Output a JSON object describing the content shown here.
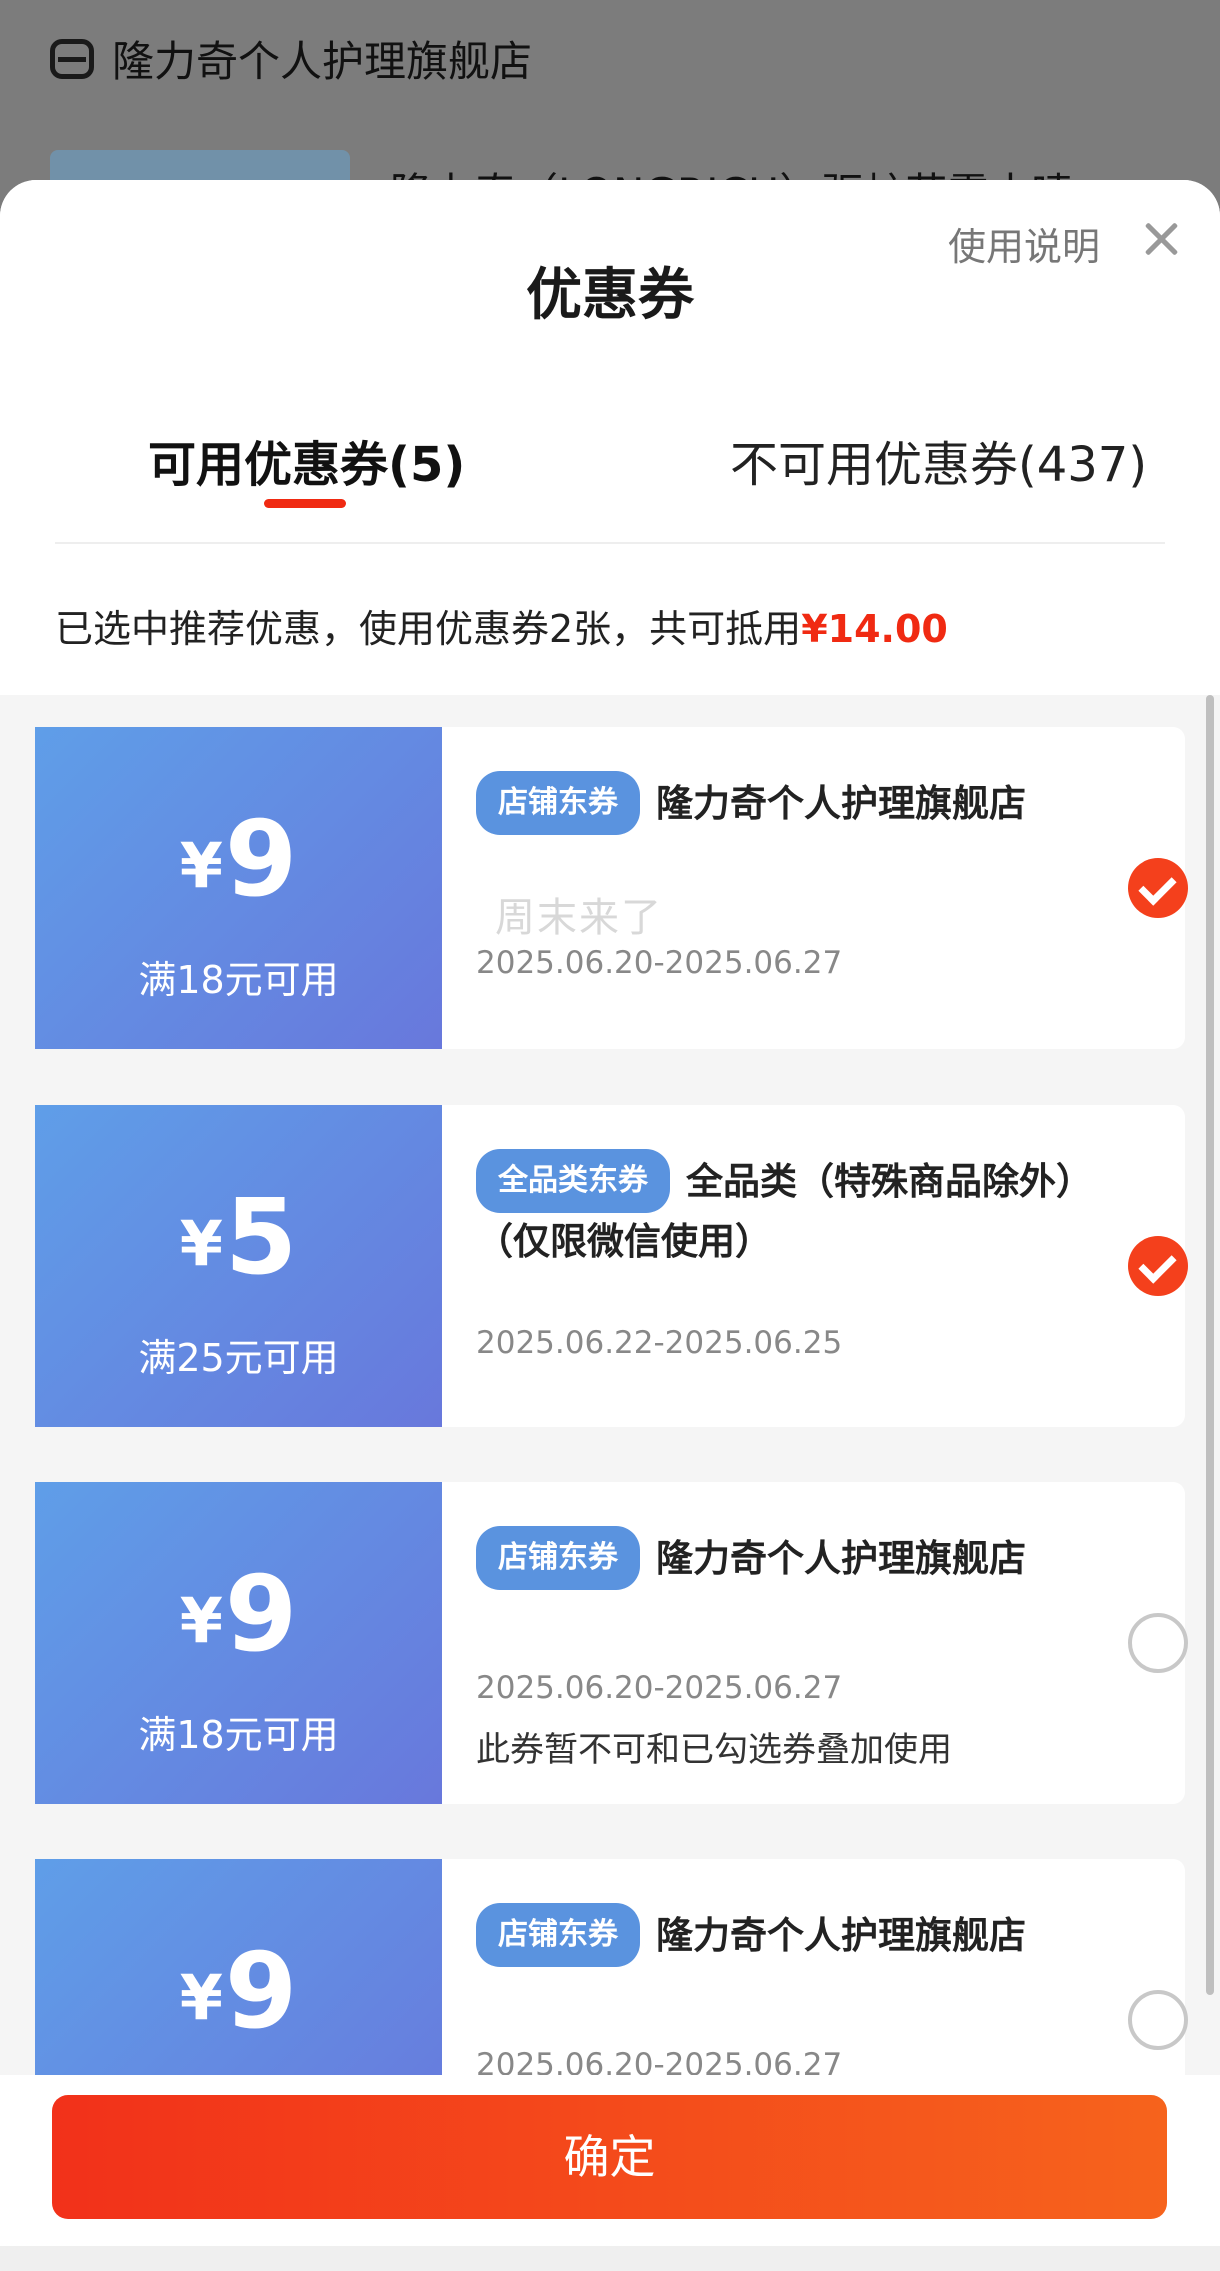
{
  "background": {
    "store_name": "隆力奇个人护理旗舰店",
    "product_title": "隆力奇（LONGRICH）驱蚊花露水喷"
  },
  "sheet": {
    "title": "优惠券",
    "help_link": "使用说明",
    "tabs": [
      {
        "label": "可用优惠券(5)",
        "active": true
      },
      {
        "label": "不可用优惠券(437)",
        "active": false
      }
    ],
    "summary_text": "已选中推荐优惠，使用优惠券2张，共可抵用",
    "summary_amount": "¥14.00"
  },
  "coupons": [
    {
      "currency": "¥",
      "amount": "9",
      "threshold": "满18元可用",
      "tag": "店铺东券",
      "name": "隆力奇个人护理旗舰店",
      "date": "2025.06.20-2025.06.27",
      "note": "",
      "selected": true
    },
    {
      "currency": "¥",
      "amount": "5",
      "threshold": "满25元可用",
      "tag": "全品类东券",
      "name": "全品类（特殊商品除外）（仅限微信使用）",
      "date": "2025.06.22-2025.06.25",
      "note": "",
      "selected": true
    },
    {
      "currency": "¥",
      "amount": "9",
      "threshold": "满18元可用",
      "tag": "店铺东券",
      "name": "隆力奇个人护理旗舰店",
      "date": "2025.06.20-2025.06.27",
      "note": "此券暂不可和已勾选券叠加使用",
      "selected": false
    },
    {
      "currency": "¥",
      "amount": "9",
      "threshold": "",
      "tag": "店铺东券",
      "name": "隆力奇个人护理旗舰店",
      "date": "2025.06.20-2025.06.27",
      "note": "",
      "selected": false
    }
  ],
  "watermark": "周末来了",
  "footer": {
    "confirm_label": "确定"
  },
  "colors": {
    "accent": "#f02a12",
    "coupon_blue": "#5f9ee8",
    "tag_blue": "#5a93df"
  }
}
